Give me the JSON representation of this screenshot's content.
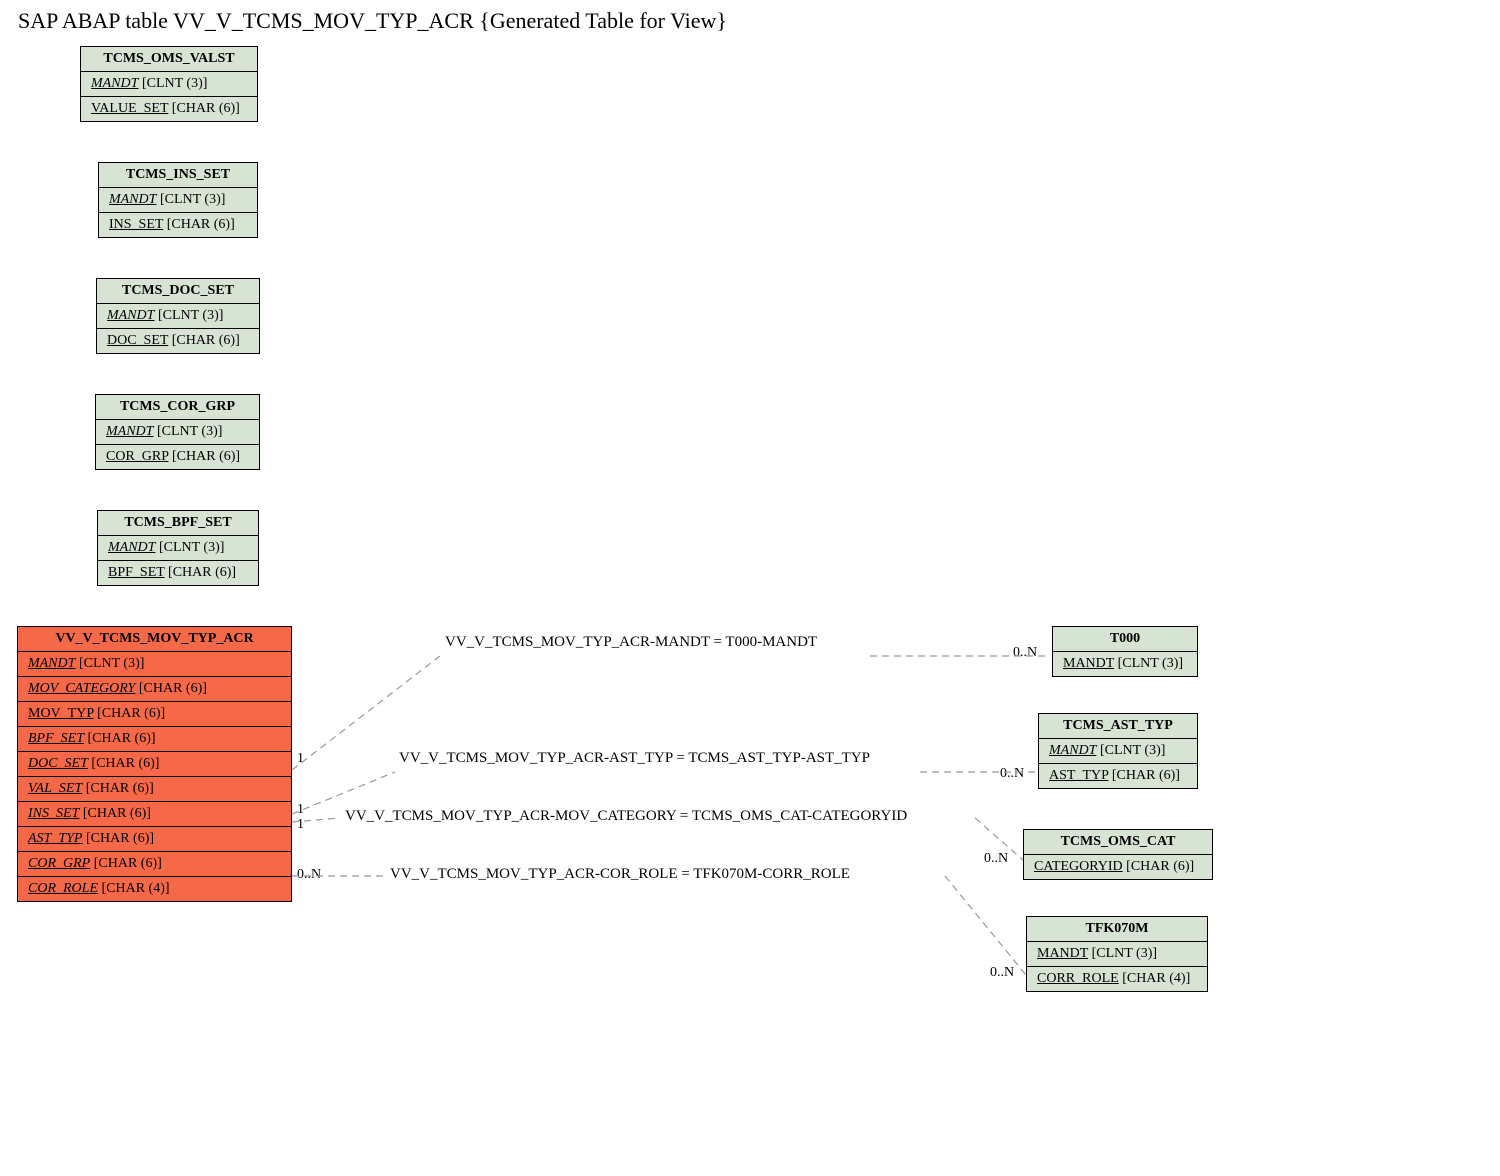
{
  "title": "SAP ABAP table VV_V_TCMS_MOV_TYP_ACR {Generated Table for View}",
  "entities": {
    "omsvalst": {
      "name": "TCMS_OMS_VALST",
      "fields": [
        {
          "name": "MANDT",
          "type": "[CLNT (3)]",
          "italic": true
        },
        {
          "name": "VALUE_SET",
          "type": "[CHAR (6)]",
          "italic": false
        }
      ]
    },
    "insset": {
      "name": "TCMS_INS_SET",
      "fields": [
        {
          "name": "MANDT",
          "type": "[CLNT (3)]",
          "italic": true
        },
        {
          "name": "INS_SET",
          "type": "[CHAR (6)]",
          "italic": false
        }
      ]
    },
    "docset": {
      "name": "TCMS_DOC_SET",
      "fields": [
        {
          "name": "MANDT",
          "type": "[CLNT (3)]",
          "italic": true
        },
        {
          "name": "DOC_SET",
          "type": "[CHAR (6)]",
          "italic": false
        }
      ]
    },
    "corgrp": {
      "name": "TCMS_COR_GRP",
      "fields": [
        {
          "name": "MANDT",
          "type": "[CLNT (3)]",
          "italic": true
        },
        {
          "name": "COR_GRP",
          "type": "[CHAR (6)]",
          "italic": false
        }
      ]
    },
    "bpfset": {
      "name": "TCMS_BPF_SET",
      "fields": [
        {
          "name": "MANDT",
          "type": "[CLNT (3)]",
          "italic": true
        },
        {
          "name": "BPF_SET",
          "type": "[CHAR (6)]",
          "italic": false
        }
      ]
    },
    "main": {
      "name": "VV_V_TCMS_MOV_TYP_ACR",
      "fields": [
        {
          "name": "MANDT",
          "type": "[CLNT (3)]",
          "italic": true
        },
        {
          "name": "MOV_CATEGORY",
          "type": "[CHAR (6)]",
          "italic": true
        },
        {
          "name": "MOV_TYP",
          "type": "[CHAR (6)]",
          "italic": false
        },
        {
          "name": "BPF_SET",
          "type": "[CHAR (6)]",
          "italic": true
        },
        {
          "name": "DOC_SET",
          "type": "[CHAR (6)]",
          "italic": true
        },
        {
          "name": "VAL_SET",
          "type": "[CHAR (6)]",
          "italic": true
        },
        {
          "name": "INS_SET",
          "type": "[CHAR (6)]",
          "italic": true
        },
        {
          "name": "AST_TYP",
          "type": "[CHAR (6)]",
          "italic": true
        },
        {
          "name": "COR_GRP",
          "type": "[CHAR (6)]",
          "italic": true
        },
        {
          "name": "COR_ROLE",
          "type": "[CHAR (4)]",
          "italic": true
        }
      ]
    },
    "t000": {
      "name": "T000",
      "fields": [
        {
          "name": "MANDT",
          "type": "[CLNT (3)]",
          "italic": false
        }
      ]
    },
    "asttyp": {
      "name": "TCMS_AST_TYP",
      "fields": [
        {
          "name": "MANDT",
          "type": "[CLNT (3)]",
          "italic": true
        },
        {
          "name": "AST_TYP",
          "type": "[CHAR (6)]",
          "italic": false
        }
      ]
    },
    "omscat": {
      "name": "TCMS_OMS_CAT",
      "fields": [
        {
          "name": "CATEGORYID",
          "type": "[CHAR (6)]",
          "italic": false
        }
      ]
    },
    "tfk070m": {
      "name": "TFK070M",
      "fields": [
        {
          "name": "MANDT",
          "type": "[CLNT (3)]",
          "italic": false
        },
        {
          "name": "CORR_ROLE",
          "type": "[CHAR (4)]",
          "italic": false
        }
      ]
    }
  },
  "relations": {
    "r1": "VV_V_TCMS_MOV_TYP_ACR-MANDT = T000-MANDT",
    "r2": "VV_V_TCMS_MOV_TYP_ACR-AST_TYP = TCMS_AST_TYP-AST_TYP",
    "r3": "VV_V_TCMS_MOV_TYP_ACR-MOV_CATEGORY = TCMS_OMS_CAT-CATEGORYID",
    "r4": "VV_V_TCMS_MOV_TYP_ACR-COR_ROLE = TFK070M-CORR_ROLE"
  },
  "cardinality": {
    "one": "1",
    "many": "0..N"
  },
  "chart_data": {
    "type": "erd",
    "description": "Entity-relationship diagram for SAP ABAP view VV_V_TCMS_MOV_TYP_ACR and related tables",
    "entities": [
      {
        "name": "VV_V_TCMS_MOV_TYP_ACR",
        "role": "main-view",
        "fields": [
          "MANDT CLNT(3)",
          "MOV_CATEGORY CHAR(6)",
          "MOV_TYP CHAR(6)",
          "BPF_SET CHAR(6)",
          "DOC_SET CHAR(6)",
          "VAL_SET CHAR(6)",
          "INS_SET CHAR(6)",
          "AST_TYP CHAR(6)",
          "COR_GRP CHAR(6)",
          "COR_ROLE CHAR(4)"
        ]
      },
      {
        "name": "TCMS_OMS_VALST",
        "fields": [
          "MANDT CLNT(3)",
          "VALUE_SET CHAR(6)"
        ]
      },
      {
        "name": "TCMS_INS_SET",
        "fields": [
          "MANDT CLNT(3)",
          "INS_SET CHAR(6)"
        ]
      },
      {
        "name": "TCMS_DOC_SET",
        "fields": [
          "MANDT CLNT(3)",
          "DOC_SET CHAR(6)"
        ]
      },
      {
        "name": "TCMS_COR_GRP",
        "fields": [
          "MANDT CLNT(3)",
          "COR_GRP CHAR(6)"
        ]
      },
      {
        "name": "TCMS_BPF_SET",
        "fields": [
          "MANDT CLNT(3)",
          "BPF_SET CHAR(6)"
        ]
      },
      {
        "name": "T000",
        "fields": [
          "MANDT CLNT(3)"
        ]
      },
      {
        "name": "TCMS_AST_TYP",
        "fields": [
          "MANDT CLNT(3)",
          "AST_TYP CHAR(6)"
        ]
      },
      {
        "name": "TCMS_OMS_CAT",
        "fields": [
          "CATEGORYID CHAR(6)"
        ]
      },
      {
        "name": "TFK070M",
        "fields": [
          "MANDT CLNT(3)",
          "CORR_ROLE CHAR(4)"
        ]
      }
    ],
    "relationships": [
      {
        "from": "VV_V_TCMS_MOV_TYP_ACR.MANDT",
        "to": "T000.MANDT",
        "from_card": "1",
        "to_card": "0..N"
      },
      {
        "from": "VV_V_TCMS_MOV_TYP_ACR.AST_TYP",
        "to": "TCMS_AST_TYP.AST_TYP",
        "from_card": "1",
        "to_card": "0..N"
      },
      {
        "from": "VV_V_TCMS_MOV_TYP_ACR.MOV_CATEGORY",
        "to": "TCMS_OMS_CAT.CATEGORYID",
        "from_card": "1",
        "to_card": "0..N"
      },
      {
        "from": "VV_V_TCMS_MOV_TYP_ACR.COR_ROLE",
        "to": "TFK070M.CORR_ROLE",
        "from_card": "0..N",
        "to_card": "0..N"
      }
    ]
  }
}
